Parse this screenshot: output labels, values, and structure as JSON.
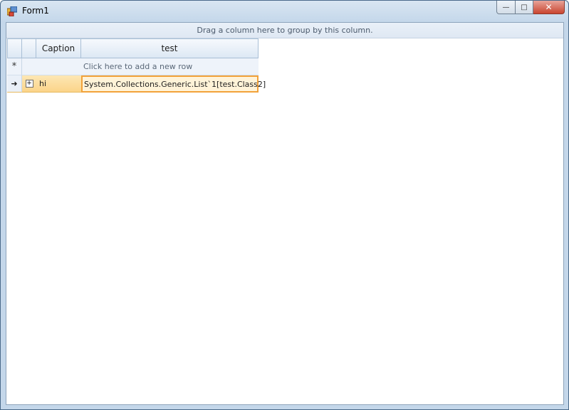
{
  "window": {
    "title": "Form1"
  },
  "group_panel": {
    "text": "Drag a column here to group by this column."
  },
  "grid": {
    "columns": [
      "Caption",
      "test"
    ],
    "new_row": {
      "indicator": "*",
      "text": "Click here to add a new row"
    },
    "rows": [
      {
        "indicator": "➜",
        "expand": "+",
        "caption": "hi",
        "test": "System.Collections.Generic.List`1[test.Class2]"
      }
    ]
  },
  "title_buttons": {
    "minimize": "—",
    "maximize": "□",
    "close": "✕"
  }
}
